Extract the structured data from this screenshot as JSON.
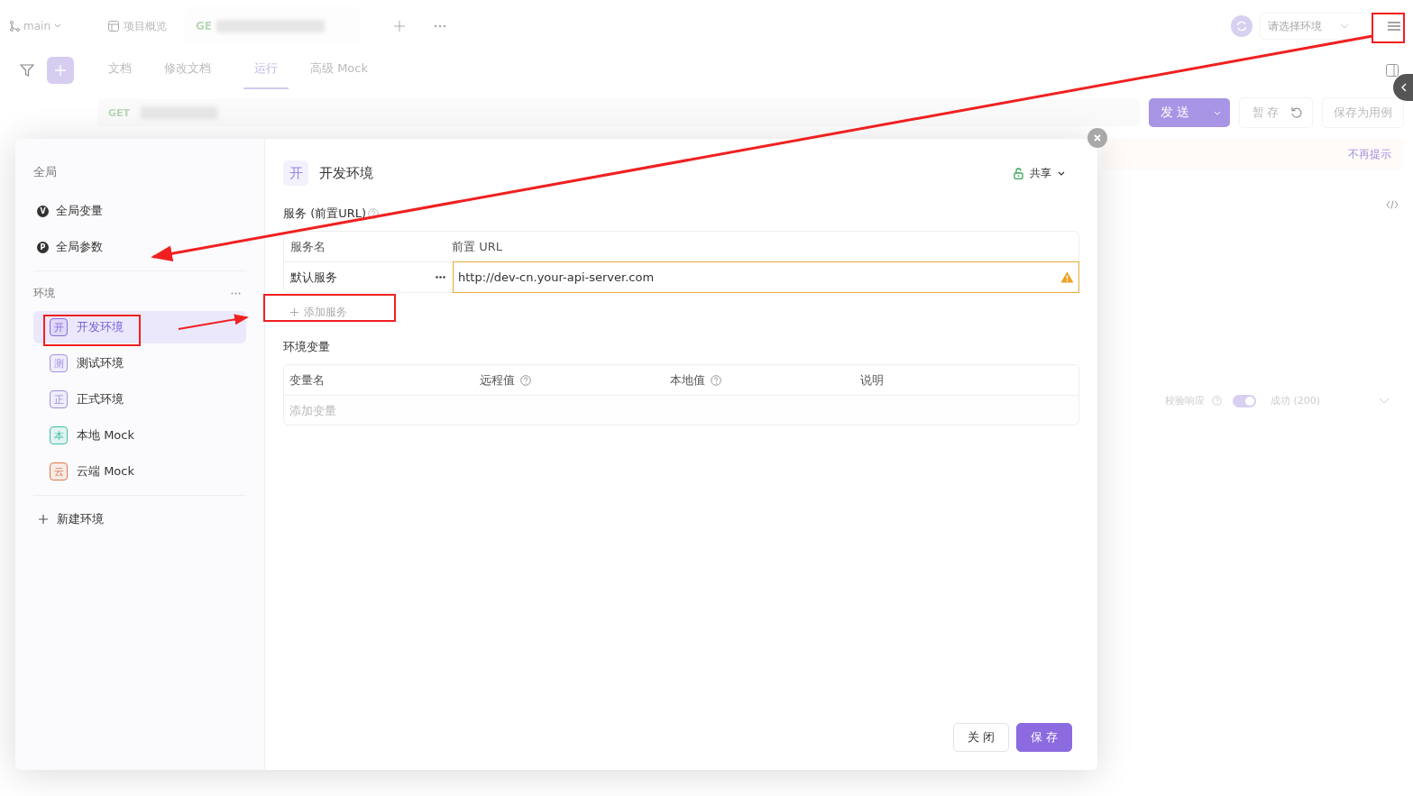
{
  "top_bar": {
    "branch": "main",
    "tabs": [
      {
        "kind": "overview",
        "label": "项目概览",
        "selected": false
      },
      {
        "kind": "request",
        "label": "GE",
        "selected": true
      }
    ],
    "environment_select": {
      "placeholder": "请选择环境"
    }
  },
  "request_tabs": [
    {
      "label": "文档",
      "selected": false
    },
    {
      "label": "修改文档",
      "selected": false
    },
    {
      "label": "运行",
      "selected": true
    },
    {
      "label": "高级 Mock",
      "selected": false
    }
  ],
  "request": {
    "method": "GET",
    "send": "发送",
    "save_draft": "暂存",
    "save_as_case": "保存为用例",
    "notice_dismiss": "不再提示",
    "validate_label": "校验响应",
    "validate_on": true,
    "response_status": "成功 (200)"
  },
  "modal": {
    "sidebar": {
      "global_heading": "全局",
      "global_items": [
        {
          "badge": "V",
          "label": "全局变量"
        },
        {
          "badge": "P",
          "label": "全局参数"
        }
      ],
      "env_heading": "环境",
      "environments": [
        {
          "badge": "开",
          "label": "开发环境",
          "selected": true,
          "color": "#8a6de0"
        },
        {
          "badge": "测",
          "label": "测试环境",
          "selected": false,
          "color": "#a58fe6"
        },
        {
          "badge": "正",
          "label": "正式环境",
          "selected": false,
          "color": "#9c90dc"
        },
        {
          "badge": "本",
          "label": "本地 Mock",
          "selected": false,
          "color": "#3dbfa6"
        },
        {
          "badge": "云",
          "label": "云端 Mock",
          "selected": false,
          "color": "#e0784a"
        }
      ],
      "new_env": "新建环境"
    },
    "header": {
      "badge": "开",
      "title": "开发环境",
      "share": "共享"
    },
    "services_heading": "服务 (前置URL)",
    "services_columns": [
      "服务名",
      "前置 URL"
    ],
    "services": [
      {
        "name": "默认服务",
        "url": "http://dev-cn.your-api-server.com",
        "warning": true
      }
    ],
    "add_service": "添加服务",
    "vars_heading": "环境变量",
    "vars_columns": [
      {
        "label": "变量名",
        "help": false
      },
      {
        "label": "远程值",
        "help": true
      },
      {
        "label": "本地值",
        "help": true
      },
      {
        "label": "说明",
        "help": false
      }
    ],
    "add_variable_placeholder": "添加变量",
    "close_button": "关 闭",
    "save_button": "保 存"
  }
}
